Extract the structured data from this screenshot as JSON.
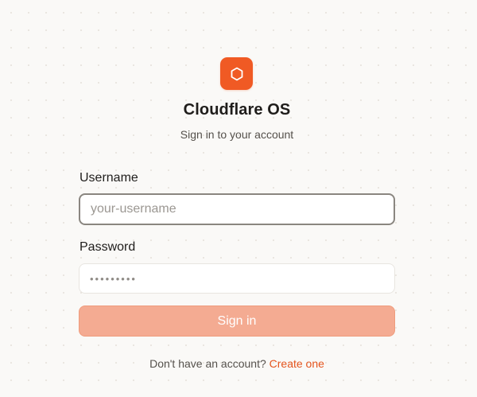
{
  "brand": {
    "logo_icon": "hexagon-icon",
    "accent_color": "#f05a24",
    "title": "Cloudflare OS",
    "subtitle": "Sign in to your account"
  },
  "form": {
    "username_label": "Username",
    "username_placeholder": "your-username",
    "username_value": "",
    "password_label": "Password",
    "password_placeholder": "•••••••••",
    "password_value": "",
    "submit_label": "Sign in",
    "submit_color": "#f4ab92"
  },
  "footer": {
    "prompt": "Don't have an account?",
    "link_label": "Create one"
  }
}
